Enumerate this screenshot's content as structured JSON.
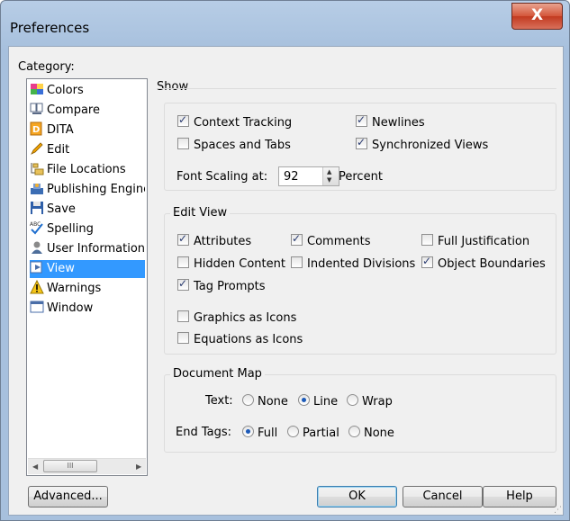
{
  "window": {
    "title": "Preferences",
    "close_label": "X"
  },
  "category": {
    "label": "Category:",
    "items": [
      {
        "label": "Colors",
        "icon": "colors-icon"
      },
      {
        "label": "Compare",
        "icon": "compare-icon"
      },
      {
        "label": "DITA",
        "icon": "dita-icon"
      },
      {
        "label": "Edit",
        "icon": "edit-pencil-icon"
      },
      {
        "label": "File Locations",
        "icon": "folder-tree-icon"
      },
      {
        "label": "Publishing Engine",
        "icon": "publishing-icon"
      },
      {
        "label": "Save",
        "icon": "floppy-disk-icon"
      },
      {
        "label": "Spelling",
        "icon": "spelling-icon"
      },
      {
        "label": "User Information",
        "icon": "user-icon"
      },
      {
        "label": "View",
        "icon": "view-icon",
        "selected": true
      },
      {
        "label": "Warnings",
        "icon": "warning-icon"
      },
      {
        "label": "Window",
        "icon": "window-icon"
      }
    ],
    "scroll_thumb": "III"
  },
  "show": {
    "title": "Show",
    "context_tracking": {
      "label": "Context Tracking",
      "checked": true
    },
    "newlines": {
      "label": "Newlines",
      "checked": true
    },
    "spaces_tabs": {
      "label": "Spaces and Tabs",
      "checked": false
    },
    "sync_views": {
      "label": "Synchronized Views",
      "checked": true
    },
    "font_scaling_label": "Font Scaling at:",
    "font_scaling_value": "92",
    "percent_label": "Percent"
  },
  "edit_view": {
    "title": "Edit View",
    "attributes": {
      "label": "Attributes",
      "checked": true
    },
    "comments": {
      "label": "Comments",
      "checked": true
    },
    "full_justification": {
      "label": "Full Justification",
      "checked": false
    },
    "hidden_content": {
      "label": "Hidden Content",
      "checked": false
    },
    "indented_divisions": {
      "label": "Indented Divisions",
      "checked": false
    },
    "object_boundaries": {
      "label": "Object Boundaries",
      "checked": true
    },
    "tag_prompts": {
      "label": "Tag Prompts",
      "checked": true
    },
    "graphics_icons": {
      "label": "Graphics as Icons",
      "checked": false
    },
    "equations_icons": {
      "label": "Equations as Icons",
      "checked": false
    }
  },
  "document_map": {
    "title": "Document Map",
    "text_label": "Text:",
    "text_options": [
      {
        "label": "None",
        "selected": false
      },
      {
        "label": "Line",
        "selected": true
      },
      {
        "label": "Wrap",
        "selected": false
      }
    ],
    "end_tags_label": "End Tags:",
    "end_tags_options": [
      {
        "label": "Full",
        "selected": true
      },
      {
        "label": "Partial",
        "selected": false
      },
      {
        "label": "None",
        "selected": false
      }
    ]
  },
  "buttons": {
    "advanced": "Advanced...",
    "ok": "OK",
    "cancel": "Cancel",
    "help": "Help"
  },
  "colors": {
    "selection": "#3399ff",
    "title_bar": "#a7c0dd",
    "close_button": "#c23a20",
    "dialog_bg": "#f0f0f0"
  }
}
